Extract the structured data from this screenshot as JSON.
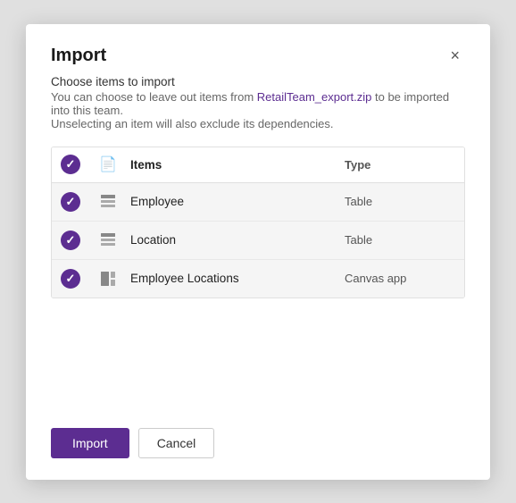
{
  "dialog": {
    "title": "Import",
    "close_label": "×",
    "subtitle": "Choose items to import",
    "description_part1": "You can choose to leave out items from ",
    "description_link": "RetailTeam_export.zip",
    "description_part2": " to be imported into this team.",
    "description_note": "Unselecting an item will also exclude its dependencies.",
    "table": {
      "header": {
        "check_col": "",
        "icon_col": "",
        "items_col": "Items",
        "type_col": "Type"
      },
      "rows": [
        {
          "id": "row-employee",
          "name": "Employee",
          "type": "Table",
          "icon": "table",
          "checked": true
        },
        {
          "id": "row-location",
          "name": "Location",
          "type": "Table",
          "icon": "table",
          "checked": true
        },
        {
          "id": "row-employee-locations",
          "name": "Employee Locations",
          "type": "Canvas app",
          "icon": "canvas",
          "checked": true
        }
      ]
    },
    "footer": {
      "import_label": "Import",
      "cancel_label": "Cancel"
    }
  }
}
